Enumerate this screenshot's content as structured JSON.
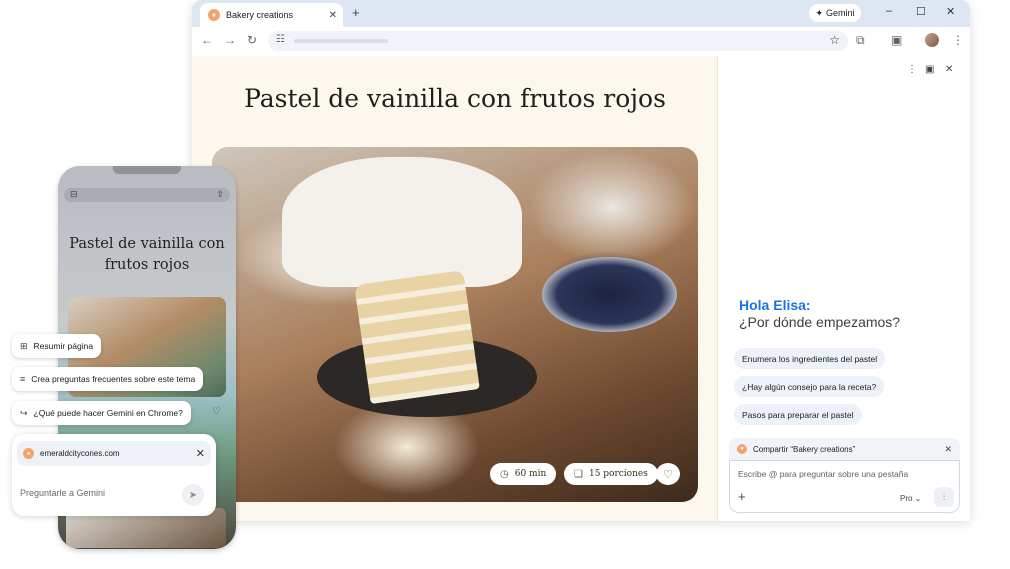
{
  "browser": {
    "tab_title": "Bakery creations",
    "tab_close": "✕",
    "new_tab": "+",
    "gemini_label": "Gemini",
    "window_controls": {
      "minimize": "–",
      "maximize": "☐",
      "close": "✕"
    }
  },
  "toolbar": {
    "back": "←",
    "forward": "→",
    "reload": "↻",
    "site_info": "☷",
    "bookmark": "☆",
    "extensions": "⧉",
    "media": "▣",
    "menu": "⋮"
  },
  "page": {
    "title": "Pastel de vainilla con frutos rojos",
    "chips": [
      {
        "icon": "◷",
        "label": "60 min"
      },
      {
        "icon": "❏",
        "label": "15 porciones"
      }
    ],
    "favorite_icon": "♡"
  },
  "panel": {
    "more_icon": "⋮",
    "detach_icon": "▣",
    "close_icon": "✕",
    "greeting_name": "Hola Elisa:",
    "greeting_question": "¿Por dónde empezamos?",
    "suggestions": [
      "Enumera los ingredientes del pastel",
      "¿Hay algún consejo para la receta?",
      "Pasos para preparar el pastel"
    ],
    "share_label": "Compartir “Bakery creations”",
    "share_close": "✕",
    "composer_placeholder": "Escribe @ para preguntar sobre una pestaña",
    "add_icon": "+",
    "model_label": "Pro ⌄",
    "voice_icon": "⫶"
  },
  "phone": {
    "title": "Pastel de vainilla con frutos rojos",
    "left_icon": "⊟",
    "share_icon": "⇪",
    "heart_icon": "♡",
    "chips": [
      {
        "icon": "⊞",
        "label": "Resumir página"
      },
      {
        "icon": "≡",
        "label": "Crea preguntas frecuentes sobre este tema"
      },
      {
        "icon": "↪",
        "label": "¿Qué puede hacer Gemini en Chrome?"
      }
    ],
    "site": "emeraldcitycones.com",
    "site_close": "✕",
    "ask_placeholder": "Preguntarle a Gemini",
    "send_icon": "➤"
  },
  "colors": {
    "accent": "#1a73e8",
    "tabbar": "#dde6f3",
    "page_bg": "#fcf8ee",
    "chip_bg": "#edf2fa"
  }
}
